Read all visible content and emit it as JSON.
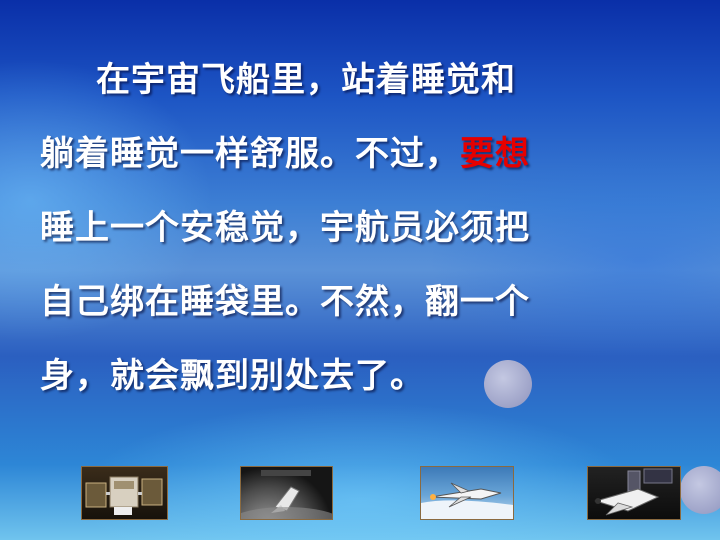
{
  "paragraph": {
    "lines": [
      [
        "在宇宙飞船里，站着睡觉和"
      ],
      [
        "躺着睡觉一样舒服。不过，",
        "要想"
      ],
      [
        "睡上一个安稳觉，宇航员必须把"
      ],
      [
        "自己绑在睡袋里。不然，翻一个"
      ],
      [
        "身，就会飘到别处去了。"
      ]
    ]
  },
  "colors": {
    "text": "#ffffff",
    "highlight": "#e60000",
    "background_top": "#0a2fa8",
    "bullet": "#a8acd0"
  },
  "images": [
    "satellite-photo",
    "space-shuttle-over-earth-photo",
    "shuttle-launch-photo",
    "space-shuttle-in-orbit-photo"
  ]
}
